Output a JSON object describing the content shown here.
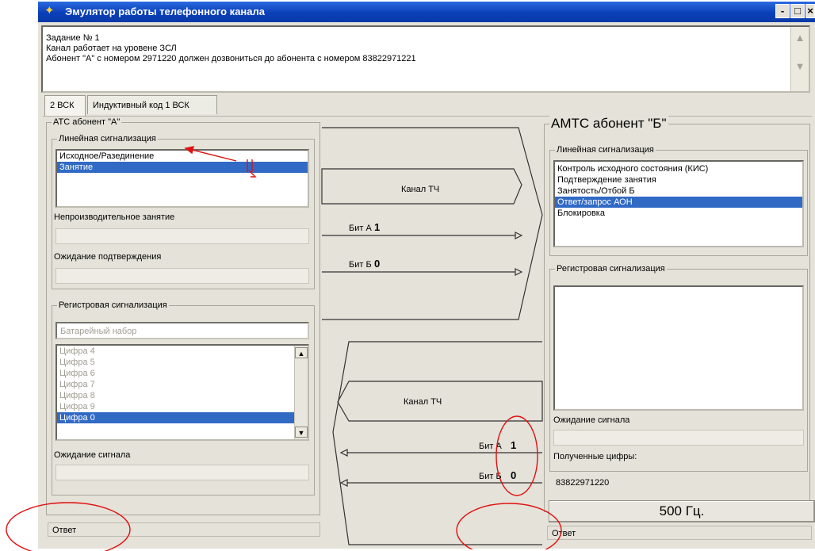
{
  "window": {
    "title": "Эмулятор работы телефонного канала",
    "buttons": [
      "-",
      "□",
      "×"
    ]
  },
  "task": {
    "lines": [
      "Задание № 1",
      "Канал работает на уровене ЗСЛ",
      "Абонент \"А\" с номером 2971220 должен дозвониться до абонента с номером 83822971221"
    ]
  },
  "tabs": [
    {
      "label": "2 ВСК",
      "active": true
    },
    {
      "label": "Индуктивный код 1 ВСК",
      "active": false
    }
  ],
  "left": {
    "group_title": "АТС абонент \"А\"",
    "line_group_title": "Линейная сигнализация",
    "line_items": [
      {
        "text": "Исходное/Разединение",
        "selected": false
      },
      {
        "text": "Занятие",
        "selected": true
      }
    ],
    "unproductive_label": "Непроизводительное занятие",
    "confirm_label": "Ожидание подтверждения",
    "reg_group_title": "Регистровая сигнализация",
    "dial_field": "Батарейный набор",
    "digits": [
      {
        "text": "Цифра 4",
        "selected": false
      },
      {
        "text": "Цифра 5",
        "selected": false
      },
      {
        "text": "Цифра 6",
        "selected": false
      },
      {
        "text": "Цифра 7",
        "selected": false
      },
      {
        "text": "Цифра 8",
        "selected": false
      },
      {
        "text": "Цифра 9",
        "selected": false
      },
      {
        "text": "Цифра 0",
        "selected": true
      }
    ],
    "wait_signal_label": "Ожидание сигнала",
    "status": "Ответ"
  },
  "center": {
    "forward": {
      "channel": "Канал ТЧ",
      "bit_a_label": "Бит А",
      "bit_a": "1",
      "bit_b_label": "Бит Б",
      "bit_b": "0"
    },
    "backward": {
      "channel": "Канал ТЧ",
      "bit_a_label": "Бит А",
      "bit_a": "1",
      "bit_b_label": "Бит Б",
      "bit_b": "0"
    }
  },
  "right": {
    "group_title": "АМТС абонент \"Б\"",
    "line_group_title": "Линейная сигнализация",
    "line_items": [
      {
        "text": "Контроль исходного состояния (КИС)",
        "selected": false
      },
      {
        "text": "Подтверждение занятия",
        "selected": false
      },
      {
        "text": "Занятость/Отбой Б",
        "selected": false
      },
      {
        "text": "Ответ/запрос АОН",
        "selected": true
      },
      {
        "text": "Блокировка",
        "selected": false
      }
    ],
    "reg_group_title": "Регистровая сигнализация",
    "wait_signal_label": "Ожидание сигнала",
    "received_label": "Полученные цифры:",
    "received_value": "83822971220",
    "tone_button": "500 Гц.",
    "status": "Ответ"
  },
  "colors": {
    "title_bar": "#0a3fb8",
    "selection": "#316ac5",
    "window_bg": "#e4e2d9",
    "annotation": "#e01010"
  }
}
